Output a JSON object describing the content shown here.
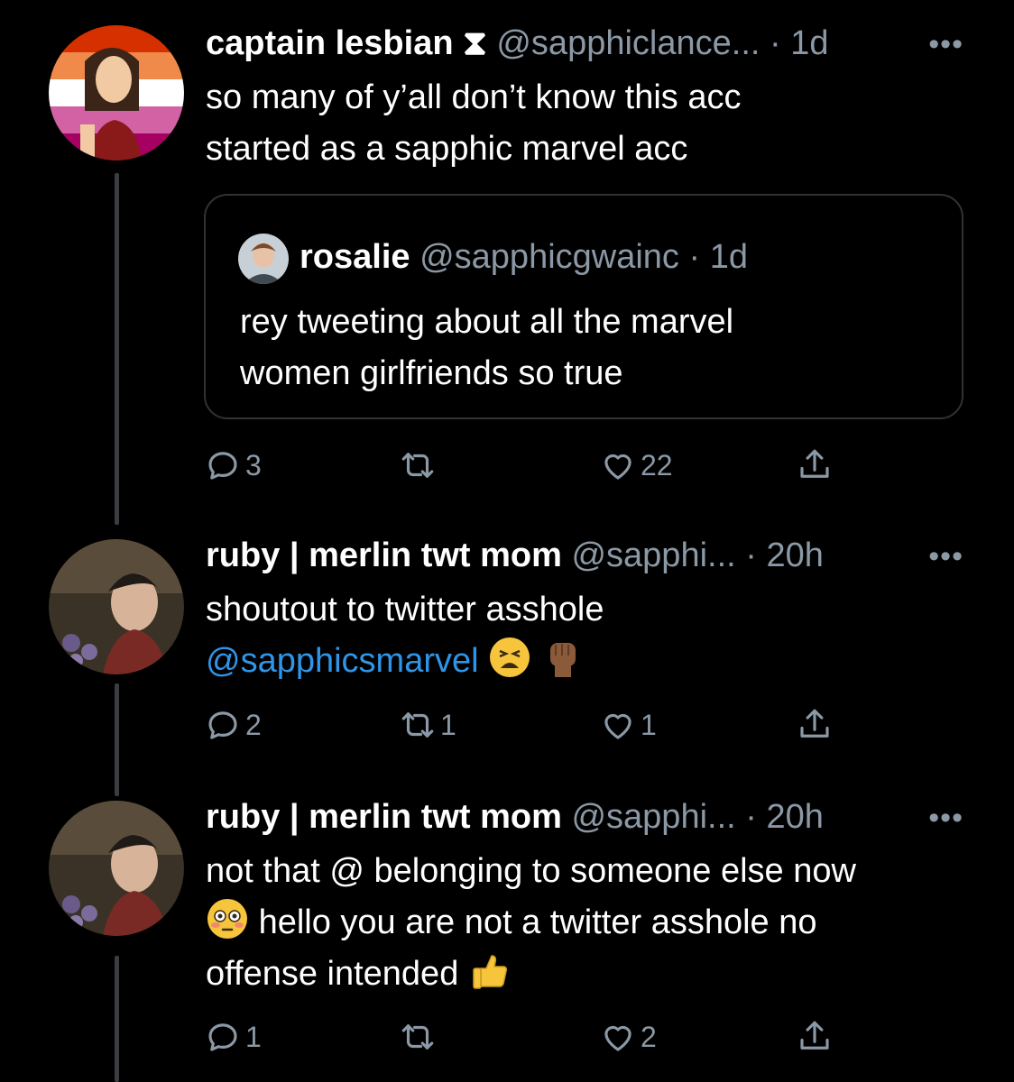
{
  "tweets": [
    {
      "name": "captain lesbian",
      "badge": "⧗",
      "handle": "@sapphiclance...",
      "time": "· 1d",
      "more": "•••",
      "text_lines": [
        "so many of y’all don’t know this acc",
        "started as a sapphic marvel acc"
      ],
      "quote": {
        "name": "rosalie",
        "handle": "@sapphicgwainc",
        "time": "· 1d",
        "text_lines": [
          "rey tweeting about all the marvel",
          "women girlfriends so true"
        ]
      },
      "actions": {
        "replies": "3",
        "retweets": "",
        "likes": "22"
      }
    },
    {
      "name": "ruby | merlin twt mom",
      "handle": "@sapphi...",
      "time": "· 20h",
      "more": "•••",
      "line1": "shoutout to twitter asshole",
      "mention": "@sapphicsmarvel",
      "emojis": [
        "tired-face-emoji",
        "raised-fist-emoji"
      ],
      "actions": {
        "replies": "2",
        "retweets": "1",
        "likes": "1"
      }
    },
    {
      "name": "ruby | merlin twt mom",
      "handle": "@sapphi...",
      "time": "· 20h",
      "more": "•••",
      "line1": "not that @ belonging to someone else now",
      "line2": "hello you are not a twitter asshole no",
      "line3": "offense intended",
      "emojis": [
        "flushed-face-emoji",
        "thumbs-up-emoji"
      ],
      "actions": {
        "replies": "1",
        "retweets": "",
        "likes": "2"
      }
    }
  ],
  "colors": {
    "background": "#000000",
    "text": "#ffffff",
    "muted": "#8b98a5",
    "link": "#2f95e8",
    "border": "#2f3336"
  },
  "icons": [
    "reply-icon",
    "retweet-icon",
    "like-icon",
    "share-icon"
  ]
}
